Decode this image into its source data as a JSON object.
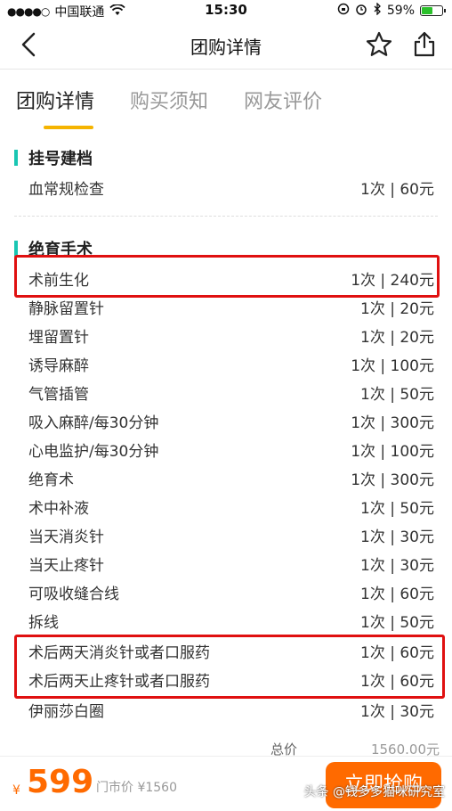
{
  "status_bar": {
    "carrier": "中国联通",
    "time": "15:30",
    "battery": "59%",
    "battery_level": 0.59
  },
  "nav": {
    "title": "团购详情"
  },
  "tabs": [
    {
      "label": "团购详情",
      "active": true
    },
    {
      "label": "购买须知",
      "active": false
    },
    {
      "label": "网友评价",
      "active": false
    }
  ],
  "sections": [
    {
      "title": "挂号建档",
      "items": [
        {
          "name": "血常规检查",
          "price": "1次 | 60元"
        }
      ]
    },
    {
      "title": "绝育手术",
      "items": [
        {
          "name": "术前生化",
          "price": "1次 | 240元"
        },
        {
          "name": "静脉留置针",
          "price": "1次 | 20元"
        },
        {
          "name": "埋留置针",
          "price": "1次 | 20元"
        },
        {
          "name": "诱导麻醉",
          "price": "1次 | 100元"
        },
        {
          "name": "气管插管",
          "price": "1次 | 50元"
        },
        {
          "name": "吸入麻醉/每30分钟",
          "price": "1次 | 300元"
        },
        {
          "name": "心电监护/每30分钟",
          "price": "1次 | 100元"
        },
        {
          "name": "绝育术",
          "price": "1次 | 300元"
        },
        {
          "name": "术中补液",
          "price": "1次 | 50元"
        },
        {
          "name": "当天消炎针",
          "price": "1次 | 30元"
        },
        {
          "name": "当天止疼针",
          "price": "1次 | 30元"
        },
        {
          "name": "可吸收缝合线",
          "price": "1次 | 60元"
        },
        {
          "name": "拆线",
          "price": "1次 | 50元"
        },
        {
          "name": "术后两天消炎针或者口服药",
          "price": "1次 | 60元"
        },
        {
          "name": "术后两天止疼针或者口服药",
          "price": "1次 | 60元"
        },
        {
          "name": "伊丽莎白圈",
          "price": "1次 | 30元"
        }
      ]
    }
  ],
  "total": {
    "label": "总价",
    "value": "1560.00元"
  },
  "bottom_bar": {
    "currency": "¥",
    "price": "599",
    "store_price": "门市价 ¥1560",
    "buy_label": "立即抢购"
  },
  "watermark": "头条 @钱多多猫咪研究室"
}
